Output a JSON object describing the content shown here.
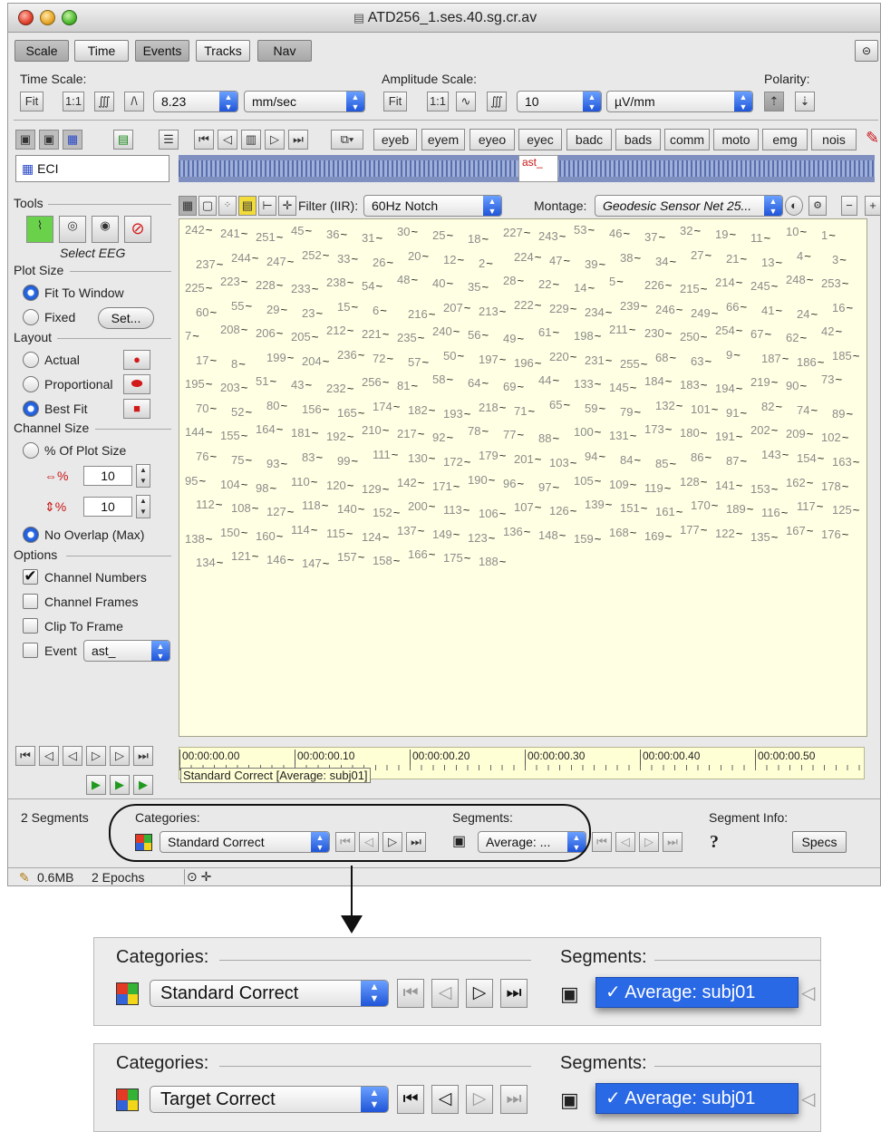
{
  "window": {
    "title": "ATD256_1.ses.40.sg.cr.av"
  },
  "toolbar": {
    "tabs": [
      "Scale",
      "Time",
      "Events",
      "Tracks",
      "Nav"
    ]
  },
  "time_scale": {
    "label": "Time Scale:",
    "fit": "Fit",
    "one_to_one": "1:1",
    "value": "8.23",
    "unit": "mm/sec"
  },
  "amplitude_scale": {
    "label": "Amplitude Scale:",
    "fit": "Fit",
    "one_to_one": "1:1",
    "value": "10",
    "unit": "µV/mm"
  },
  "polarity": {
    "label": "Polarity:"
  },
  "event_tabs": [
    "eyeb",
    "eyem",
    "eyeo",
    "eyec",
    "badc",
    "bads",
    "comm",
    "moto",
    "emg",
    "nois"
  ],
  "track": {
    "label": "ECI",
    "event_marker": "ast_"
  },
  "filter": {
    "label": "Filter (IIR):",
    "value": "60Hz Notch"
  },
  "montage": {
    "label": "Montage:",
    "value": "Geodesic Sensor Net 25..."
  },
  "tools": {
    "label": "Tools",
    "caption": "Select EEG"
  },
  "plot_size": {
    "label": "Plot Size",
    "fit_to_window": "Fit To Window",
    "fixed": "Fixed",
    "set_button": "Set..."
  },
  "layout": {
    "label": "Layout",
    "actual": "Actual",
    "proportional": "Proportional",
    "best_fit": "Best Fit"
  },
  "channel_size": {
    "label": "Channel Size",
    "percent": "% Of Plot Size",
    "width_value": "10",
    "height_value": "10",
    "no_overlap": "No Overlap (Max)"
  },
  "options": {
    "label": "Options",
    "channel_numbers": "Channel Numbers",
    "channel_frames": "Channel Frames",
    "clip_to_frame": "Clip To Frame",
    "event": "Event",
    "event_value": "ast_"
  },
  "channels": [
    "242",
    "241",
    "251",
    "45",
    "36",
    "31",
    "30",
    "25",
    "18",
    "227",
    "243",
    "53",
    "46",
    "37",
    "32",
    "19",
    "11",
    "10",
    "1",
    "237",
    "244",
    "247",
    "252",
    "33",
    "26",
    "20",
    "12",
    "2",
    "224",
    "47",
    "39",
    "38",
    "34",
    "27",
    "21",
    "13",
    "4",
    "3",
    "225",
    "223",
    "228",
    "233",
    "238",
    "54",
    "48",
    "40",
    "35",
    "28",
    "22",
    "14",
    "5",
    "226",
    "215",
    "214",
    "245",
    "248",
    "253",
    "60",
    "55",
    "29",
    "23",
    "15",
    "6",
    "216",
    "207",
    "213",
    "222",
    "229",
    "234",
    "239",
    "246",
    "249",
    "66",
    "41",
    "24",
    "16",
    "7",
    "208",
    "206",
    "205",
    "212",
    "221",
    "235",
    "240",
    "56",
    "49",
    "61",
    "198",
    "211",
    "230",
    "250",
    "254",
    "67",
    "62",
    "42",
    "17",
    "8",
    "199",
    "204",
    "236",
    "72",
    "57",
    "50",
    "197",
    "196",
    "220",
    "231",
    "255",
    "68",
    "63",
    "9",
    "187",
    "186",
    "185",
    "195",
    "203",
    "51",
    "43",
    "232",
    "256",
    "81",
    "58",
    "64",
    "69",
    "44",
    "133",
    "145",
    "184",
    "183",
    "194",
    "219",
    "90",
    "73",
    "70",
    "52",
    "80",
    "156",
    "165",
    "174",
    "182",
    "193",
    "218",
    "71",
    "65",
    "59",
    "79",
    "132",
    "101",
    "91",
    "82",
    "74",
    "89",
    "144",
    "155",
    "164",
    "181",
    "192",
    "210",
    "217",
    "92",
    "78",
    "77",
    "88",
    "100",
    "131",
    "173",
    "180",
    "191",
    "202",
    "209",
    "102",
    "76",
    "75",
    "93",
    "83",
    "99",
    "111",
    "130",
    "172",
    "179",
    "201",
    "103",
    "94",
    "84",
    "85",
    "86",
    "87",
    "143",
    "154",
    "163",
    "95",
    "104",
    "98",
    "110",
    "120",
    "129",
    "142",
    "171",
    "190",
    "96",
    "97",
    "105",
    "109",
    "119",
    "128",
    "141",
    "153",
    "162",
    "178",
    "112",
    "108",
    "127",
    "118",
    "140",
    "152",
    "200",
    "113",
    "106",
    "107",
    "126",
    "139",
    "151",
    "161",
    "170",
    "189",
    "116",
    "117",
    "125",
    "138",
    "150",
    "160",
    "114",
    "115",
    "124",
    "137",
    "149",
    "123",
    "136",
    "148",
    "159",
    "168",
    "169",
    "177",
    "122",
    "135",
    "167",
    "176",
    "134",
    "121",
    "146",
    "147",
    "157",
    "158",
    "166",
    "175",
    "188"
  ],
  "timeline": {
    "ticks": [
      "00:00:00.00",
      "00:00:00.10",
      "00:00:00.20",
      "00:00:00.30",
      "00:00:00.40",
      "00:00:00.50"
    ],
    "caption": "Standard Correct [Average: subj01]"
  },
  "bottom": {
    "segments_count": "2 Segments",
    "categories_label": "Categories:",
    "category_value": "Standard Correct",
    "segments_label": "Segments:",
    "segment_value": "Average: ...",
    "segment_info_label": "Segment Info:",
    "question": "?",
    "specs_button": "Specs"
  },
  "status": {
    "memory": "0.6MB",
    "epochs": "2 Epochs"
  },
  "zoom1": {
    "categories_label": "Categories:",
    "category_value": "Standard Correct",
    "segments_label": "Segments:",
    "menu_item": "Average: subj01"
  },
  "zoom2": {
    "categories_label": "Categories:",
    "category_value": "Target Correct",
    "segments_label": "Segments:",
    "menu_item": "Average: subj01"
  },
  "icons": [
    "close-light-icon",
    "minimize-light-icon",
    "zoom-light-icon",
    "document-icon",
    "link-icon",
    "select-eeg-icon",
    "eye-icon",
    "stop-icon",
    "checkmark-icon",
    "pencil-icon",
    "arrow-down-icon",
    "category-grid-icon",
    "film-strip-icon"
  ],
  "colors": {
    "selection_blue": "#2a69e6",
    "plot_background": "#ffffe3",
    "stop_red": "#d21a1a"
  }
}
